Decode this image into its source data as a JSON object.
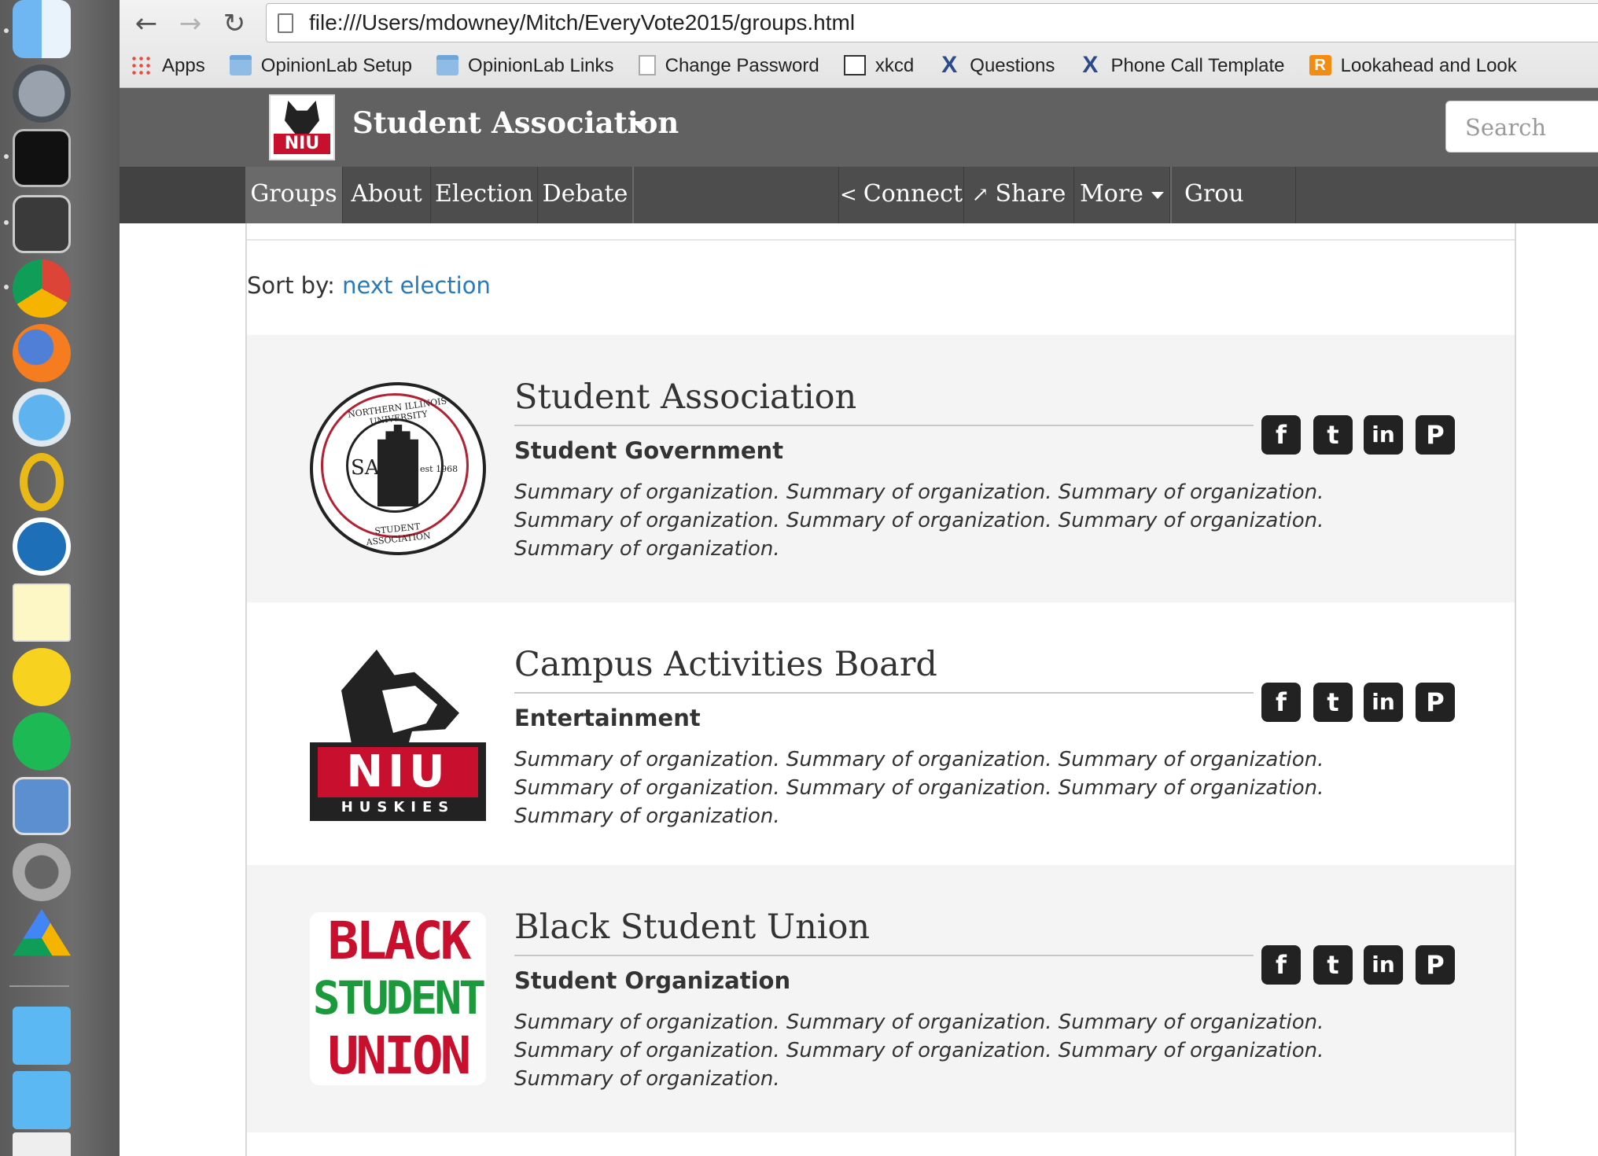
{
  "browser": {
    "url": "file:///Users/mdowney/Mitch/EveryVote2015/groups.html",
    "bookmarks": [
      "Apps",
      "OpinionLab Setup",
      "OpinionLab Links",
      "Change Password",
      "xkcd",
      "Questions",
      "Phone Call Template",
      "Lookahead and Look"
    ]
  },
  "site": {
    "brand": "Student Association",
    "search_placeholder": "Search",
    "nav": [
      "Groups",
      "About",
      "Election",
      "Debate"
    ],
    "nav_right": [
      "Connect",
      "Share",
      "More",
      "Grou"
    ]
  },
  "sort": {
    "label": "Sort by:",
    "value": "next election"
  },
  "orgs": [
    {
      "name": "Student Association",
      "category": "Student Government",
      "summary": "Summary of organization. Summary of organization. Summary of organization. Summary of organization. Summary of organization. Summary of organization. Summary of organization.",
      "logo": {
        "ring_top": "NORTHERN ILLINOIS UNIVERSITY",
        "ring_bottom": "STUDENT ASSOCIATION",
        "initials": "SA",
        "est": "est 1968"
      }
    },
    {
      "name": "Campus Activities Board",
      "category": "Entertainment",
      "summary": "Summary of organization. Summary of organization. Summary of organization. Summary of organization. Summary of organization. Summary of organization. Summary of organization.",
      "logo": {
        "letters": "NIU",
        "word": "HUSKIES"
      }
    },
    {
      "name": "Black Student Union",
      "category": "Student Organization",
      "summary": "Summary of organization. Summary of organization. Summary of organization. Summary of organization. Summary of organization. Summary of organization. Summary of organization.",
      "logo": {
        "lines": [
          "BLACK",
          "STUDENT",
          "UNION"
        ]
      }
    }
  ],
  "social_icons": [
    "facebook-icon",
    "twitter-icon",
    "linkedin-icon",
    "pinterest-icon"
  ],
  "colors": {
    "nav_bg": "#4d4d4d",
    "header_bg": "#616161",
    "link": "#2a7ab8",
    "niu_red": "#c8102e"
  }
}
